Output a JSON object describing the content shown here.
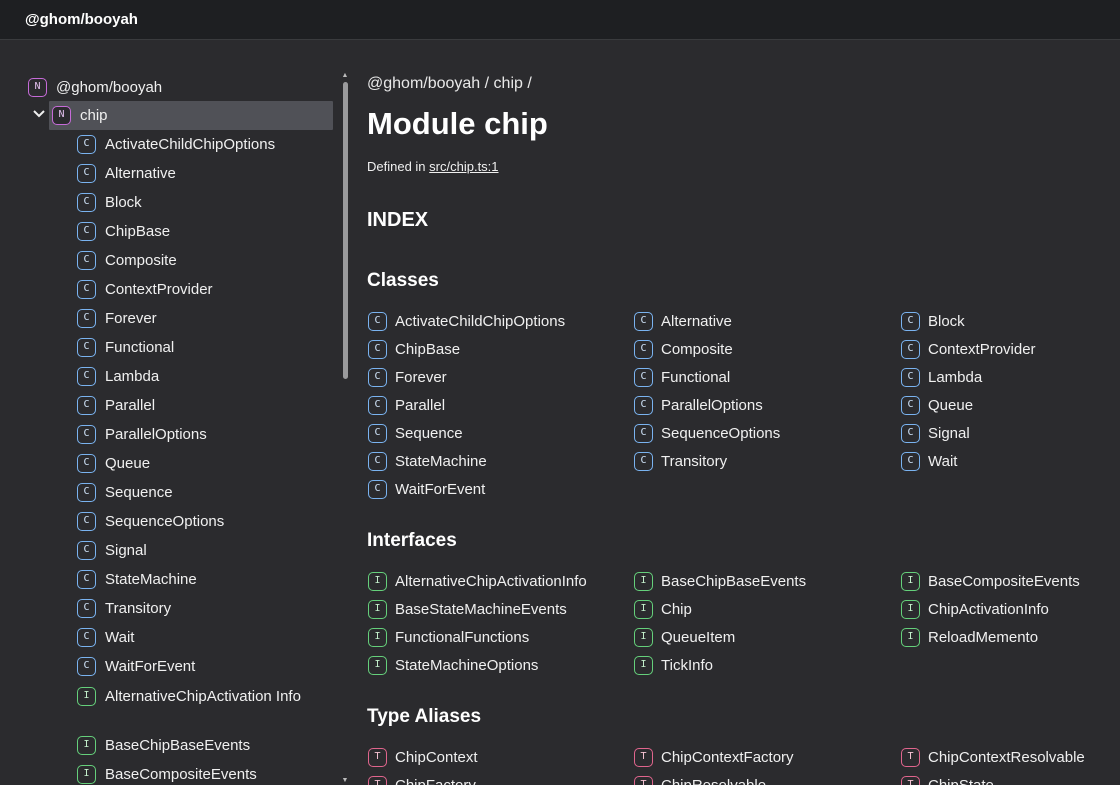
{
  "header": {
    "title": "@ghom/booyah"
  },
  "sidebar": {
    "root": {
      "badge": "N",
      "label": "@ghom/booyah"
    },
    "module": {
      "badge": "N",
      "label": "chip"
    },
    "items": [
      {
        "badge": "C",
        "label": "ActivateChildChipOptions"
      },
      {
        "badge": "C",
        "label": "Alternative"
      },
      {
        "badge": "C",
        "label": "Block"
      },
      {
        "badge": "C",
        "label": "ChipBase"
      },
      {
        "badge": "C",
        "label": "Composite"
      },
      {
        "badge": "C",
        "label": "ContextProvider"
      },
      {
        "badge": "C",
        "label": "Forever"
      },
      {
        "badge": "C",
        "label": "Functional"
      },
      {
        "badge": "C",
        "label": "Lambda"
      },
      {
        "badge": "C",
        "label": "Parallel"
      },
      {
        "badge": "C",
        "label": "ParallelOptions"
      },
      {
        "badge": "C",
        "label": "Queue"
      },
      {
        "badge": "C",
        "label": "Sequence"
      },
      {
        "badge": "C",
        "label": "SequenceOptions"
      },
      {
        "badge": "C",
        "label": "Signal"
      },
      {
        "badge": "C",
        "label": "StateMachine"
      },
      {
        "badge": "C",
        "label": "Transitory"
      },
      {
        "badge": "C",
        "label": "Wait"
      },
      {
        "badge": "C",
        "label": "WaitForEvent"
      },
      {
        "badge": "I",
        "label": "AlternativeChipActivation Info"
      },
      {
        "badge": "I",
        "label": "BaseChipBaseEvents"
      },
      {
        "badge": "I",
        "label": "BaseCompositeEvents"
      }
    ]
  },
  "main": {
    "breadcrumb": "@ghom/booyah / chip /",
    "title": "Module chip",
    "defined_prefix": "Defined in",
    "defined_link": "src/chip.ts:1",
    "index_heading": "INDEX",
    "classes_heading": "Classes",
    "classes": [
      "ActivateChildChipOptions",
      "Alternative",
      "Block",
      "ChipBase",
      "Composite",
      "ContextProvider",
      "Forever",
      "Functional",
      "Lambda",
      "Parallel",
      "ParallelOptions",
      "Queue",
      "Sequence",
      "SequenceOptions",
      "Signal",
      "StateMachine",
      "Transitory",
      "Wait",
      "WaitForEvent"
    ],
    "interfaces_heading": "Interfaces",
    "interfaces": [
      "AlternativeChipActivationInfo",
      "BaseChipBaseEvents",
      "BaseCompositeEvents",
      "BaseStateMachineEvents",
      "Chip",
      "ChipActivationInfo",
      "FunctionalFunctions",
      "QueueItem",
      "ReloadMemento",
      "StateMachineOptions",
      "TickInfo"
    ],
    "type_aliases_heading": "Type Aliases",
    "type_aliases": [
      "ChipContext",
      "ChipContextFactory",
      "ChipContextResolvable",
      "ChipFactory",
      "ChipResolvable",
      "ChipState"
    ]
  },
  "badges": {
    "N": "N",
    "C": "C",
    "I": "I",
    "T": "T"
  },
  "colors": {
    "namespace": "#c66bd8",
    "class": "#7ab3f0",
    "interface": "#65d07b",
    "type_alias": "#e0658d",
    "background": "#2b2b2e",
    "header_bg": "#1e1f22",
    "selected_bg": "#505157"
  },
  "icons": {
    "expand": "chevron-down-icon"
  }
}
